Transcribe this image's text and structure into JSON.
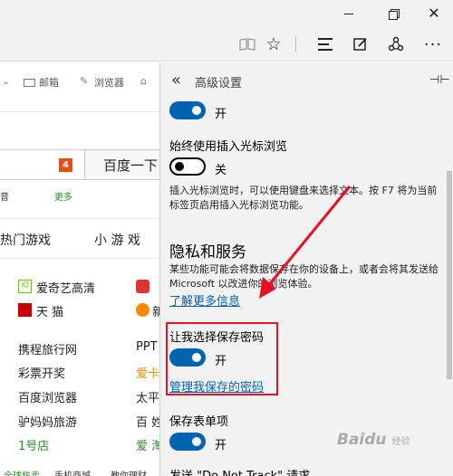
{
  "titlebar": {
    "minimize_icon": "minimize-icon",
    "maximize_icon": "restore-icon",
    "close_glyph": "✕"
  },
  "toolbar": {
    "icons": [
      "reading-view-icon",
      "favorite-star-icon",
      "hub-icon",
      "web-note-icon",
      "share-icon",
      "more-icon"
    ],
    "star_glyph": "☆",
    "share_glyph": "⟁",
    "more_glyph": "···"
  },
  "page": {
    "nav": {
      "mail": "邮箱",
      "browser": "浏览器"
    },
    "search_badge": "4",
    "search_button": "百度一下",
    "small_left": "音",
    "more_link": "更多",
    "tabs": [
      "热门游戏",
      "小 游 戏"
    ],
    "sites": [
      "爱奇艺高清",
      "天  猫",
      "携程旅行网",
      "彩票开奖",
      "百度浏览器",
      "驴妈妈旅游",
      "1号店"
    ],
    "sites_right": [
      "PPT",
      "爱卡",
      "太平",
      "百 姓",
      "爱 淘"
    ],
    "footer": [
      "全球热卖",
      "手机商城",
      "教你理财"
    ]
  },
  "panel": {
    "title": "高级设置",
    "back_glyph": "«",
    "pin_glyph": "⊣⊢",
    "toggle1_label": "开",
    "caret_title": "始终使用插入光标浏览",
    "toggle2_label": "关",
    "caret_desc": "插入光标浏览时，可以使用键盘来选择文本。按 F7 将为当前标签页启用插入光标浏览功能。",
    "privacy_heading": "隐私和服务",
    "privacy_desc": "某些功能可能会将数据保存在你的设备上，或者会将其发送给 Microsoft 以改进你的浏览体验。",
    "learn_more": "了解更多信息",
    "save_pw_title": "让我选择保存密码",
    "toggle3_label": "开",
    "manage_pw": "管理我保存的密码",
    "save_form_title": "保存表单项",
    "toggle4_label": "开",
    "dnt_title": "发送 \"Do Not Track\" 请求"
  },
  "colors": {
    "accent": "#0063b1",
    "highlight": "#e81123",
    "chrome": "#f2f2f2"
  },
  "watermark": {
    "brand": "Bai",
    "paw": "du",
    "suffix": "经验"
  }
}
